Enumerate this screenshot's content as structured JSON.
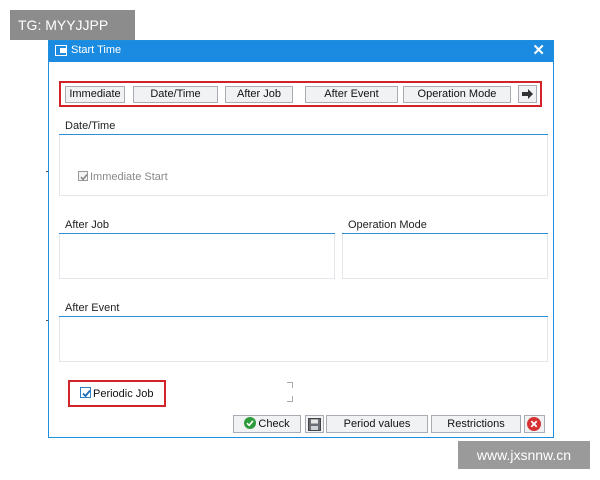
{
  "watermarks": {
    "top": "TG: MYYJJPP",
    "bottom": "www.jxsnnw.cn"
  },
  "dialog": {
    "title": "Start Time",
    "close_label": "✕",
    "accent_color": "#1a8be0",
    "highlight_color": "#d3232a"
  },
  "toolbar": {
    "buttons": [
      {
        "label": "Immediate"
      },
      {
        "label": "Date/Time"
      },
      {
        "label": "After Job"
      },
      {
        "label": "After Event"
      },
      {
        "label": "Operation Mode"
      }
    ],
    "more_icon": "arrow-right-icon"
  },
  "groups": {
    "date_time": {
      "title": "Date/Time",
      "immediate_start": {
        "label": "Immediate Start",
        "checked": true,
        "disabled": true
      }
    },
    "after_job": {
      "title": "After Job"
    },
    "operation_mode": {
      "title": "Operation Mode"
    },
    "after_event": {
      "title": "After Event"
    }
  },
  "periodic_job": {
    "label": "Periodic Job",
    "checked": true
  },
  "footer": {
    "check_label": "Check",
    "check_icon": "check-circle-icon",
    "save_icon": "save-icon",
    "period_values_label": "Period values",
    "restrictions_label": "Restrictions",
    "cancel_icon": "cancel-icon"
  }
}
